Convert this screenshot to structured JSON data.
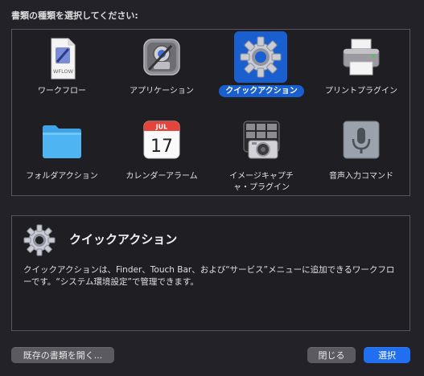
{
  "prompt": "書類の種類を選択してください:",
  "doc_types": [
    {
      "label": "ワークフロー",
      "icon": "workflow-document-icon",
      "icon_text": "WFLOW"
    },
    {
      "label": "アプリケーション",
      "icon": "automator-robot-icon"
    },
    {
      "label": "クイックアクション",
      "icon": "gear-icon",
      "selected": true
    },
    {
      "label": "プリントプラグイン",
      "icon": "printer-icon"
    },
    {
      "label": "フォルダアクション",
      "icon": "folder-icon"
    },
    {
      "label": "カレンダーアラーム",
      "icon": "calendar-icon",
      "month": "JUL",
      "day": "17"
    },
    {
      "label": "イメージキャプチ\nャ・プラグイン",
      "icon": "image-capture-icon"
    },
    {
      "label": "音声入力コマンド",
      "icon": "microphone-icon"
    }
  ],
  "description": {
    "title": "クイックアクション",
    "text": "クイックアクションは、Finder、Touch Bar、および“サービス”メニューに追加できるワークフローです。“システム環境設定”で管理できます。"
  },
  "buttons": {
    "open_existing": "既存の書類を開く...",
    "close": "閉じる",
    "choose": "選択"
  },
  "colors": {
    "selection": "#1a5fd0",
    "primary_button": "#1f6ff0",
    "background": "#242229"
  }
}
